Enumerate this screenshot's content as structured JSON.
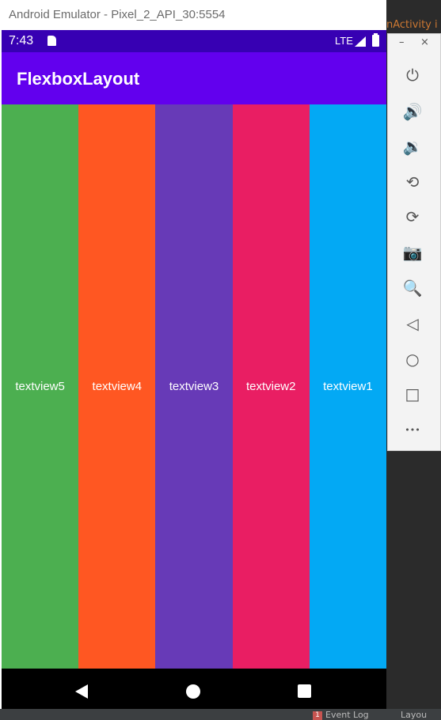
{
  "emulator": {
    "window_title": "Android Emulator - Pixel_2_API_30:5554"
  },
  "status_bar": {
    "time": "7:43",
    "network": "LTE"
  },
  "app_bar": {
    "title": "FlexboxLayout"
  },
  "text_views": [
    {
      "label": "textview5",
      "color": "#4caf50"
    },
    {
      "label": "textview4",
      "color": "#ff5722"
    },
    {
      "label": "textview3",
      "color": "#673ab7"
    },
    {
      "label": "textview2",
      "color": "#e91e63"
    },
    {
      "label": "textview1",
      "color": "#03a9f4"
    }
  ],
  "side_toolbar": {
    "minimize": "–",
    "close": "×",
    "buttons": [
      {
        "icon": "power-icon",
        "glyph": "⏻"
      },
      {
        "icon": "volume-up-icon",
        "glyph": "🔊"
      },
      {
        "icon": "volume-down-icon",
        "glyph": "🔉"
      },
      {
        "icon": "rotate-left-icon",
        "glyph": "⟲"
      },
      {
        "icon": "rotate-right-icon",
        "glyph": "⟳"
      },
      {
        "icon": "camera-icon",
        "glyph": "📷"
      },
      {
        "icon": "zoom-icon",
        "glyph": "🔍"
      },
      {
        "icon": "back-icon",
        "glyph": "◁"
      },
      {
        "icon": "home-icon",
        "glyph": "○"
      },
      {
        "icon": "overview-icon",
        "glyph": "□"
      },
      {
        "icon": "more-icon",
        "glyph": "•••"
      }
    ]
  },
  "ide": {
    "code_fragment": "nActivity i",
    "event_log_count": "1",
    "event_log": "Event Log",
    "layout_tab": "Layou"
  },
  "colors": {
    "status_bar": "#3700b3",
    "app_bar": "#6200ee",
    "nav_bar": "#000000"
  }
}
